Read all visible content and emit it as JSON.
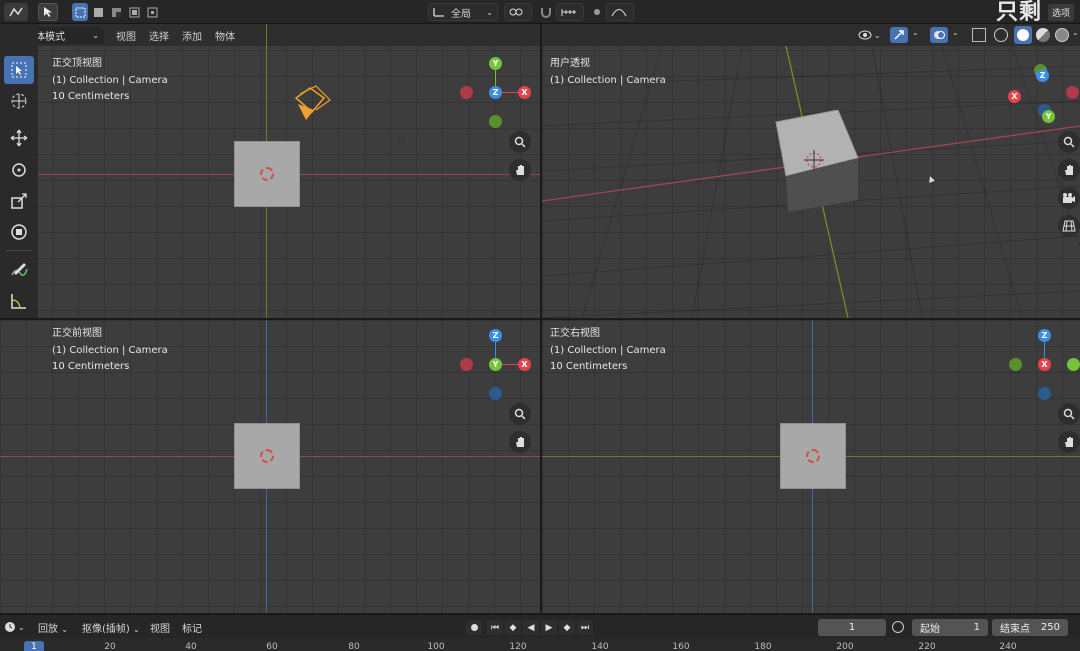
{
  "topbar": {
    "transform_orientation": "全局",
    "options_label": "选项",
    "watermark": "只剩"
  },
  "viewport_header": {
    "mode": "物体模式",
    "menus": [
      "视图",
      "选择",
      "添加",
      "物体"
    ]
  },
  "viewports": {
    "top": {
      "name": "正交顶视图",
      "collection": "(1) Collection | Camera",
      "scale": "10 Centimeters"
    },
    "persp": {
      "name": "用户透视",
      "collection": "(1) Collection | Camera"
    },
    "front": {
      "name": "正交前视图",
      "collection": "(1) Collection | Camera",
      "scale": "10 Centimeters"
    },
    "right": {
      "name": "正交右视图",
      "collection": "(1) Collection | Camera",
      "scale": "10 Centimeters"
    }
  },
  "gizmo_labels": {
    "x": "X",
    "y": "Y",
    "z": "Z"
  },
  "colors": {
    "x_axis": "#e8424c",
    "y_axis": "#76c33a",
    "z_axis": "#3b8fe8",
    "accent": "#4772b3",
    "camera": "#f0a030"
  },
  "timeline": {
    "playback": "回放",
    "keying": "抠像(插帧)",
    "view": "视图",
    "marker": "标记",
    "current_frame": "1",
    "start_label": "起始",
    "start_value": "1",
    "end_label": "结束点",
    "end_value": "250"
  },
  "ruler": {
    "current": "1",
    "ticks": [
      "20",
      "40",
      "60",
      "80",
      "100",
      "120",
      "140",
      "160",
      "180",
      "200",
      "220",
      "240"
    ]
  },
  "icons": [
    "select-box-icon",
    "cursor-icon",
    "move-icon",
    "rotate-icon",
    "scale-icon",
    "transform-icon",
    "annotate-icon",
    "measure-icon",
    "zoom-icon",
    "hand-icon",
    "camera-view-icon",
    "grid-icon",
    "play-icon"
  ]
}
